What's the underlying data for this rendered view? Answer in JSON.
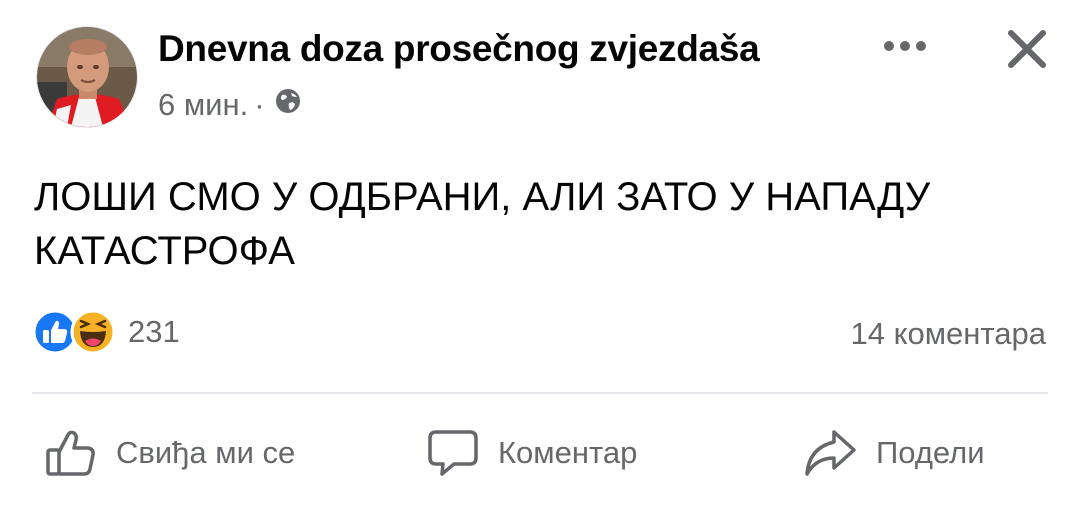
{
  "post": {
    "page_name": "Dnevna doza prosečnog zvjezdaša",
    "time_ago": "6 мин.",
    "separator": "·",
    "privacy_icon": "globe-icon",
    "text_line1": "ЛОШИ СМО У ОДБРАНИ, АЛИ ЗАТО У НАПАДУ",
    "text_line2": "КАТАСТРОФА"
  },
  "header_controls": {
    "more_icon": "more-horizontal-icon",
    "close_icon": "close-icon"
  },
  "stats": {
    "reaction_icons": [
      "like-reaction-icon",
      "haha-reaction-icon"
    ],
    "reaction_count": "231",
    "comments": "14 коментара"
  },
  "actions": [
    {
      "label": "Свиђа ми се",
      "icon": "thumbs-up-icon"
    },
    {
      "label": "Коментар",
      "icon": "comment-bubble-icon"
    },
    {
      "label": "Подели",
      "icon": "share-arrow-icon"
    }
  ],
  "colors": {
    "text_primary": "#050505",
    "text_secondary": "#65676b",
    "like_blue": "#1877f2",
    "haha_yellow": "#f7b125",
    "divider": "#e4e6eb"
  }
}
